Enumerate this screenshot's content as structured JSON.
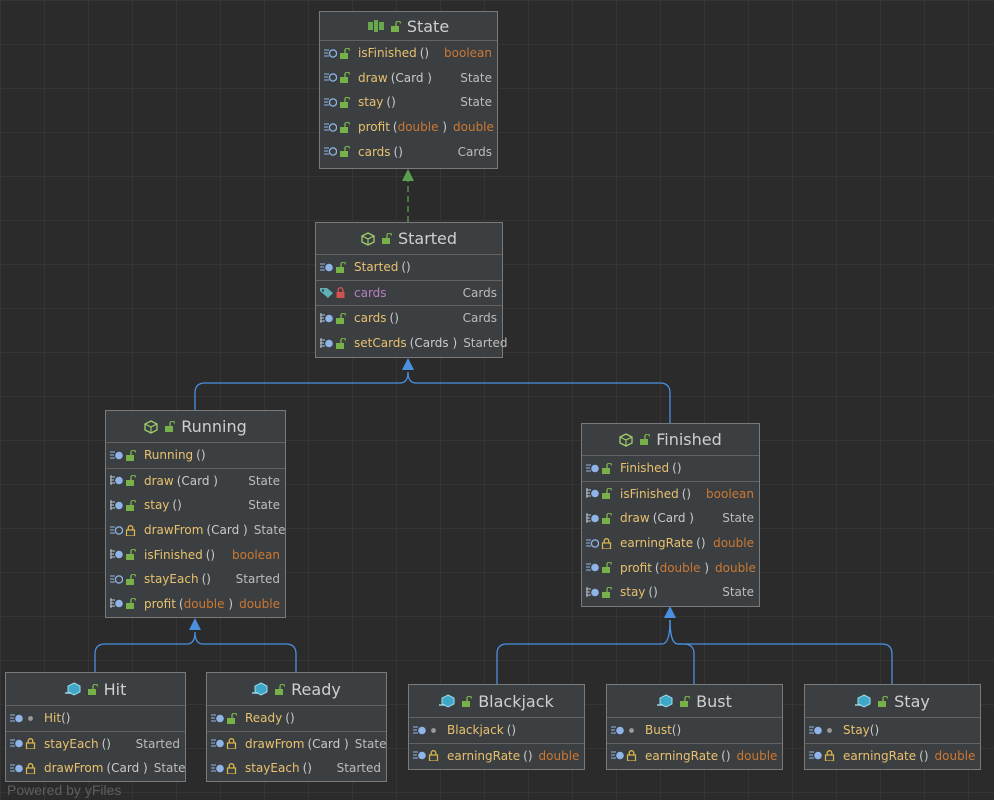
{
  "footer": "Powered by yFiles",
  "colors": {
    "implements_edge": "#5aa050",
    "extends_edge": "#4a8fe0",
    "keyword": "#cc7832",
    "member": "#e8c16f"
  },
  "nodes": {
    "state": {
      "title": "State",
      "kind": "interface",
      "rows": [
        {
          "name": "isFinished",
          "params": "()",
          "type": "boolean",
          "type_kw": true
        },
        {
          "name": "draw",
          "params": "(Card )",
          "type": "State"
        },
        {
          "name": "stay",
          "params": "()",
          "type": "State"
        },
        {
          "name": "profit",
          "params_pre": "(",
          "params_kw": "double",
          "params_post": " )",
          "type": "double",
          "type_kw": true
        },
        {
          "name": "cards",
          "params": "()",
          "type": "Cards"
        }
      ]
    },
    "started": {
      "title": "Started",
      "kind": "abstract",
      "ctor": {
        "name": "Started",
        "params": "()"
      },
      "field": {
        "name": "cards",
        "type": "Cards"
      },
      "rows": [
        {
          "name": "cards",
          "params": "()",
          "type": "Cards"
        },
        {
          "name": "setCards",
          "params": "(Cards )",
          "type": "Started"
        }
      ]
    },
    "running": {
      "title": "Running",
      "kind": "abstract",
      "ctor": {
        "name": "Running",
        "params": "()"
      },
      "rows": [
        {
          "name": "draw",
          "params": "(Card )",
          "type": "State"
        },
        {
          "name": "stay",
          "params": "()",
          "type": "State"
        },
        {
          "name": "drawFrom",
          "params": "(Card )",
          "type": "State"
        },
        {
          "name": "isFinished",
          "params": "()",
          "type": "boolean",
          "type_kw": true
        },
        {
          "name": "stayEach",
          "params": "()",
          "type": "Started"
        },
        {
          "name": "profit",
          "params_pre": "(",
          "params_kw": "double",
          "params_post": " )",
          "type": "double",
          "type_kw": true
        }
      ]
    },
    "finished": {
      "title": "Finished",
      "kind": "abstract",
      "ctor": {
        "name": "Finished",
        "params": "()"
      },
      "rows": [
        {
          "name": "isFinished",
          "params": "()",
          "type": "boolean",
          "type_kw": true
        },
        {
          "name": "draw",
          "params": "(Card )",
          "type": "State"
        },
        {
          "name": "earningRate",
          "params": "()",
          "type": "double",
          "type_kw": true
        },
        {
          "name": "profit",
          "params_pre": "(",
          "params_kw": "double",
          "params_post": " )",
          "type": "double",
          "type_kw": true
        },
        {
          "name": "stay",
          "params": "()",
          "type": "State"
        }
      ]
    },
    "hit": {
      "title": "Hit",
      "kind": "class",
      "ctor": {
        "name": "Hit",
        "params": "()"
      },
      "rows": [
        {
          "name": "stayEach",
          "params": "()",
          "type": "Started"
        },
        {
          "name": "drawFrom",
          "params": "(Card )",
          "type": "State"
        }
      ]
    },
    "ready": {
      "title": "Ready",
      "kind": "class",
      "ctor": {
        "name": "Ready",
        "params": "()"
      },
      "rows": [
        {
          "name": "drawFrom",
          "params": "(Card )",
          "type": "State"
        },
        {
          "name": "stayEach",
          "params": "()",
          "type": "Started"
        }
      ]
    },
    "blackjack": {
      "title": "Blackjack",
      "kind": "class",
      "ctor": {
        "name": "Blackjack",
        "params": "()"
      },
      "rows": [
        {
          "name": "earningRate",
          "params": "()",
          "type": "double",
          "type_kw": true
        }
      ]
    },
    "bust": {
      "title": "Bust",
      "kind": "class",
      "ctor": {
        "name": "Bust",
        "params": "()"
      },
      "rows": [
        {
          "name": "earningRate",
          "params": "()",
          "type": "double",
          "type_kw": true
        }
      ]
    },
    "stay": {
      "title": "Stay",
      "kind": "class",
      "ctor": {
        "name": "Stay",
        "params": "()"
      },
      "rows": [
        {
          "name": "earningRate",
          "params": "()",
          "type": "double",
          "type_kw": true
        }
      ]
    }
  }
}
